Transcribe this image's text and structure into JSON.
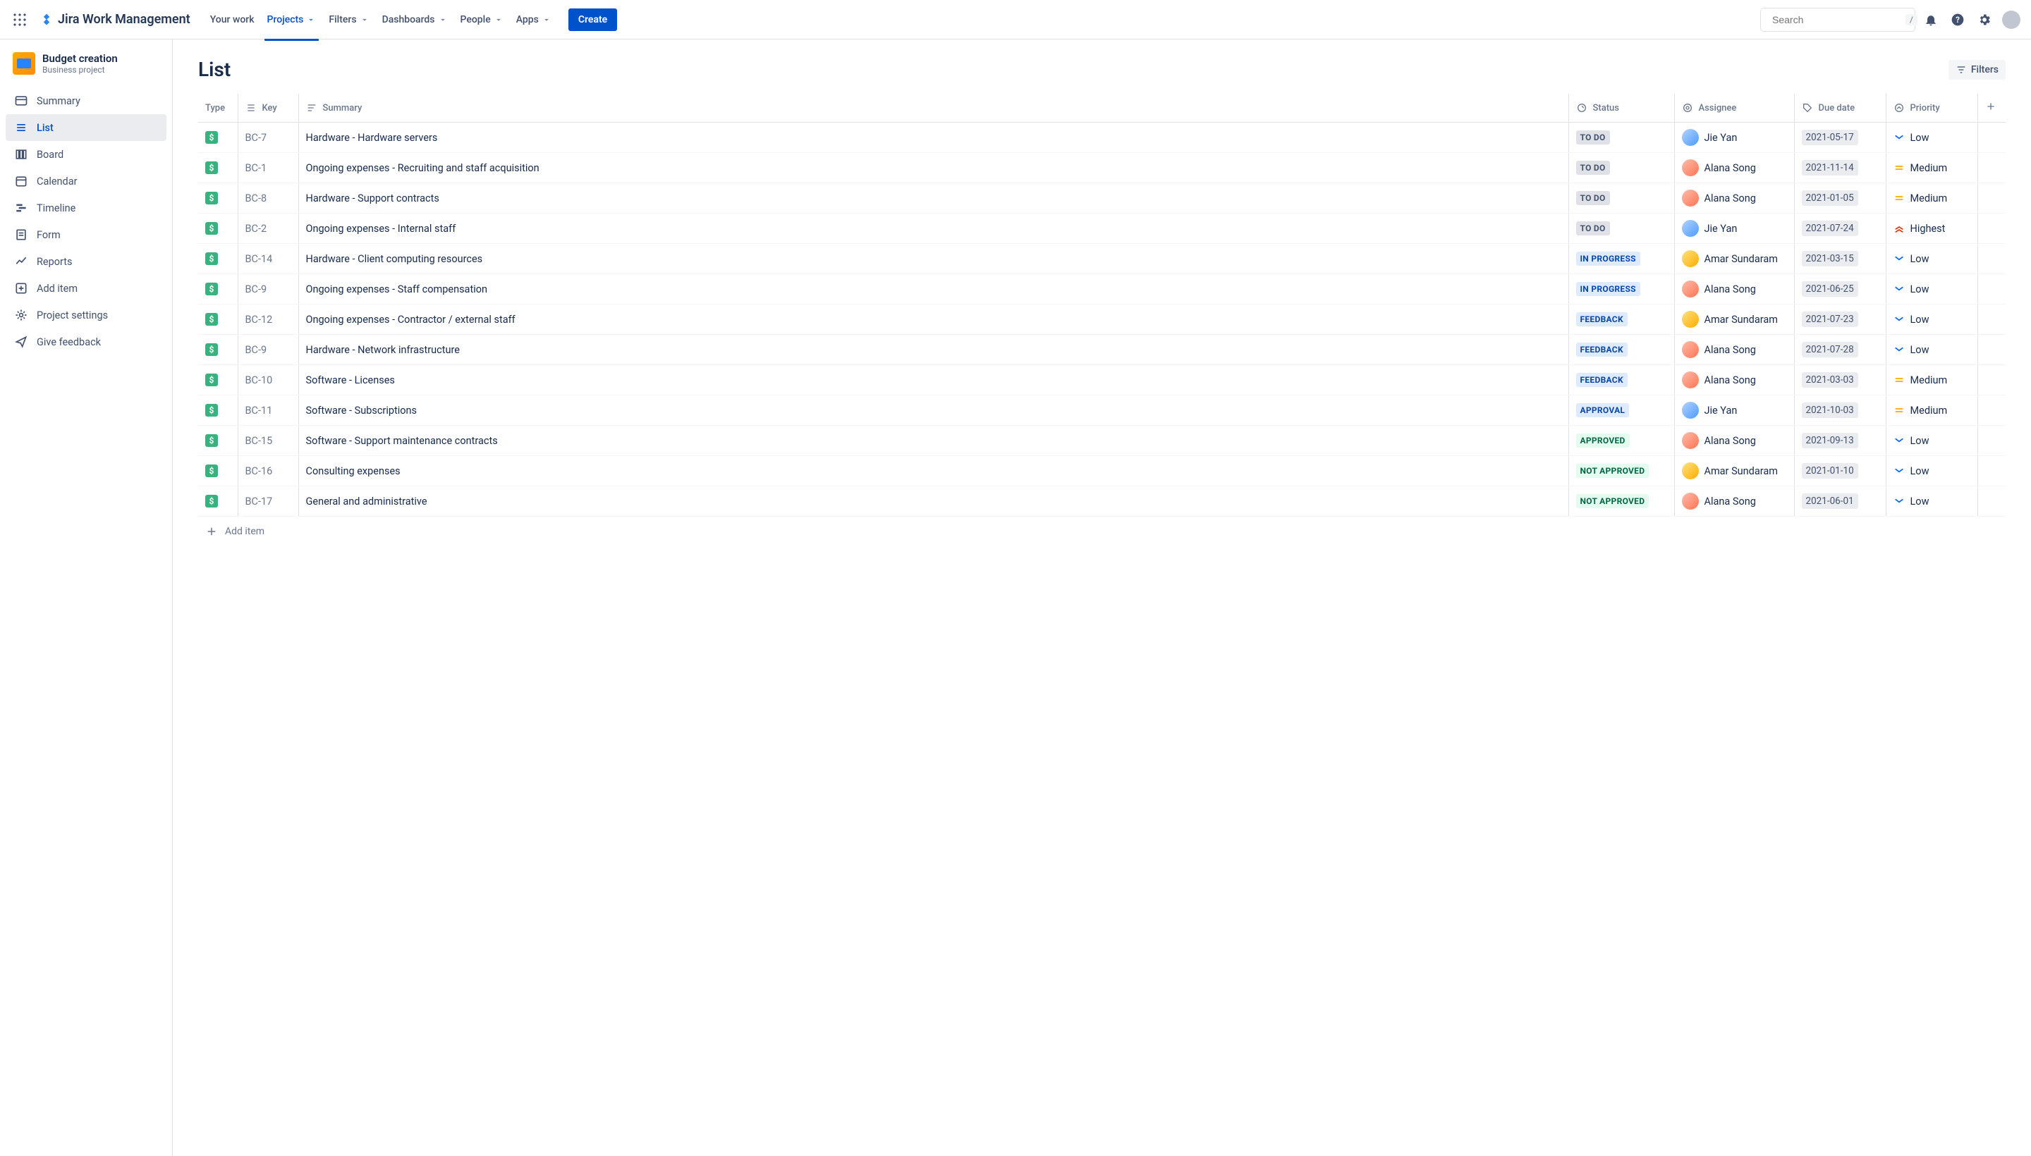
{
  "topbar": {
    "product_name": "Jira Work Management",
    "nav": [
      {
        "label": "Your work",
        "dropdown": false
      },
      {
        "label": "Projects",
        "dropdown": true,
        "active": true
      },
      {
        "label": "Filters",
        "dropdown": true
      },
      {
        "label": "Dashboards",
        "dropdown": true
      },
      {
        "label": "People",
        "dropdown": true
      },
      {
        "label": "Apps",
        "dropdown": true
      }
    ],
    "create_label": "Create",
    "search_placeholder": "Search",
    "search_kbd": "/"
  },
  "sidebar": {
    "project_name": "Budget creation",
    "project_type": "Business project",
    "items": [
      {
        "key": "summary",
        "label": "Summary"
      },
      {
        "key": "list",
        "label": "List",
        "active": true
      },
      {
        "key": "board",
        "label": "Board"
      },
      {
        "key": "calendar",
        "label": "Calendar"
      },
      {
        "key": "timeline",
        "label": "Timeline"
      },
      {
        "key": "form",
        "label": "Form"
      },
      {
        "key": "reports",
        "label": "Reports"
      },
      {
        "key": "add-item",
        "label": "Add item"
      },
      {
        "key": "project-settings",
        "label": "Project settings"
      },
      {
        "key": "give-feedback",
        "label": "Give feedback"
      }
    ]
  },
  "page": {
    "title": "List",
    "filters_label": "Filters",
    "add_item_label": "Add item"
  },
  "columns": {
    "type": "Type",
    "key": "Key",
    "summary": "Summary",
    "status": "Status",
    "assignee": "Assignee",
    "due": "Due date",
    "priority": "Priority"
  },
  "rows": [
    {
      "key": "BC-7",
      "summary": "Hardware - Hardware servers",
      "status": "TO DO",
      "status_class": "st-todo",
      "assignee": "Jie Yan",
      "av": "c0",
      "due": "2021-05-17",
      "priority": "Low",
      "pclass": "prio-low"
    },
    {
      "key": "BC-1",
      "summary": "Ongoing expenses - Recruiting and staff acquisition",
      "status": "TO DO",
      "status_class": "st-todo",
      "assignee": "Alana Song",
      "av": "c1",
      "due": "2021-11-14",
      "priority": "Medium",
      "pclass": "prio-medium"
    },
    {
      "key": "BC-8",
      "summary": "Hardware - Support contracts",
      "status": "TO DO",
      "status_class": "st-todo",
      "assignee": "Alana Song",
      "av": "c1",
      "due": "2021-01-05",
      "priority": "Medium",
      "pclass": "prio-medium"
    },
    {
      "key": "BC-2",
      "summary": "Ongoing expenses - Internal staff",
      "status": "TO DO",
      "status_class": "st-todo",
      "assignee": "Jie Yan",
      "av": "c0",
      "due": "2021-07-24",
      "priority": "Highest",
      "pclass": "prio-highest"
    },
    {
      "key": "BC-14",
      "summary": "Hardware - Client computing resources",
      "status": "IN PROGRESS",
      "status_class": "st-inprogress",
      "assignee": "Amar Sundaram",
      "av": "c2",
      "due": "2021-03-15",
      "priority": "Low",
      "pclass": "prio-low"
    },
    {
      "key": "BC-9",
      "summary": "Ongoing expenses - Staff compensation",
      "status": "IN PROGRESS",
      "status_class": "st-inprogress",
      "assignee": "Alana Song",
      "av": "c1",
      "due": "2021-06-25",
      "priority": "Low",
      "pclass": "prio-low"
    },
    {
      "key": "BC-12",
      "summary": "Ongoing expenses - Contractor / external staff",
      "status": "FEEDBACK",
      "status_class": "st-feedback",
      "assignee": "Amar Sundaram",
      "av": "c2",
      "due": "2021-07-23",
      "priority": "Low",
      "pclass": "prio-low"
    },
    {
      "key": "BC-9",
      "summary": "Hardware - Network infrastructure",
      "status": "FEEDBACK",
      "status_class": "st-feedback",
      "assignee": "Alana Song",
      "av": "c1",
      "due": "2021-07-28",
      "priority": "Low",
      "pclass": "prio-low"
    },
    {
      "key": "BC-10",
      "summary": "Software - Licenses",
      "status": "FEEDBACK",
      "status_class": "st-feedback",
      "assignee": "Alana Song",
      "av": "c1",
      "due": "2021-03-03",
      "priority": "Medium",
      "pclass": "prio-medium"
    },
    {
      "key": "BC-11",
      "summary": "Software - Subscriptions",
      "status": "APPROVAL",
      "status_class": "st-approval",
      "assignee": "Jie Yan",
      "av": "c0",
      "due": "2021-10-03",
      "priority": "Medium",
      "pclass": "prio-medium"
    },
    {
      "key": "BC-15",
      "summary": "Software - Support maintenance contracts",
      "status": "APPROVED",
      "status_class": "st-approved",
      "assignee": "Alana Song",
      "av": "c1",
      "due": "2021-09-13",
      "priority": "Low",
      "pclass": "prio-low"
    },
    {
      "key": "BC-16",
      "summary": "Consulting expenses",
      "status": "NOT APPROVED",
      "status_class": "st-not-approved",
      "assignee": "Amar Sundaram",
      "av": "c2",
      "due": "2021-01-10",
      "priority": "Low",
      "pclass": "prio-low"
    },
    {
      "key": "BC-17",
      "summary": "General and administrative",
      "status": "NOT APPROVED",
      "status_class": "st-not-approved",
      "assignee": "Alana Song",
      "av": "c1",
      "due": "2021-06-01",
      "priority": "Low",
      "pclass": "prio-low"
    }
  ]
}
